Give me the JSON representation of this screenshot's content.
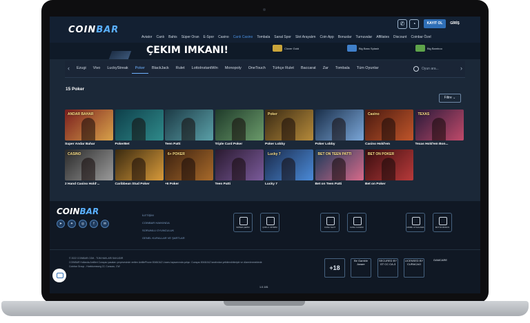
{
  "header": {
    "logo_prefix": "COIN",
    "logo_suffix": "BAR",
    "register_label": "KAYIT OL",
    "login_label": "GİRİŞ",
    "icons": [
      "phone-icon",
      "whatsapp-icon"
    ]
  },
  "main_nav": [
    "Aviator",
    "Canlı",
    "Bahis",
    "Süper Oran",
    "E-Spor",
    "Casino",
    "Canlı Casino",
    "Tombala",
    "Sanal Spor",
    "Slot Arayalım",
    "Coin App",
    "Bonuslar",
    "Turnuvalar",
    "Affiliates",
    "Discount",
    "Coinbar Özel"
  ],
  "main_nav_active": "Canlı Casino",
  "banner": {
    "headline": "ÇEKIM IMKANI!",
    "wins": [
      {
        "label": "Clover Gold",
        "color": "#caa53a"
      },
      {
        "label": "Big Bass Splash",
        "color": "#3f7fc9"
      },
      {
        "label": "Big Bamboo",
        "color": "#5ea34a"
      }
    ]
  },
  "categories": [
    "Ezugi",
    "Vivo",
    "LuckyStreak",
    "Poker",
    "BlackJack",
    "Rulet",
    "LottoInstantWin",
    "Monopoly",
    "OneTouch",
    "Türkçe Rulet",
    "Baccarat",
    "Zar",
    "Tombala",
    "Tüm Oyunlar"
  ],
  "active_category": "Poker",
  "search": {
    "placeholder": "Oyun ara..."
  },
  "results": {
    "count_label": "15 Poker",
    "filter_label": "Filtre"
  },
  "games": [
    {
      "name": "Super Andar Bahar",
      "tag": "ANDAR BAHAR",
      "c1": "#7a1e1e",
      "c2": "#d8a24a"
    },
    {
      "name": "PokerBet",
      "tag": "",
      "c1": "#0e3f4a",
      "c2": "#2f8a8a"
    },
    {
      "name": "Teen Patti",
      "tag": "",
      "c1": "#1c3a45",
      "c2": "#5aa0a8"
    },
    {
      "name": "Triple Card Poker",
      "tag": "",
      "c1": "#1f3b2a",
      "c2": "#6a9a6a"
    },
    {
      "name": "Poker Lobby",
      "tag": "Poker",
      "c1": "#3a2a14",
      "c2": "#b58a3a"
    },
    {
      "name": "Poker Lobby",
      "tag": "",
      "c1": "#1a2f4a",
      "c2": "#7aa6d8"
    },
    {
      "name": "Casino Hold'em",
      "tag": "Casino",
      "c1": "#4a1a10",
      "c2": "#c0552a"
    },
    {
      "name": "Texas Hold'em Bon...",
      "tag": "TEXAS",
      "c1": "#2a1a3a",
      "c2": "#c04a6a"
    },
    {
      "name": "2 Hand Casino Hold'...",
      "tag": "CASINO",
      "c1": "#2a2a2a",
      "c2": "#9a9a9a"
    },
    {
      "name": "Caribbean Stud Poker",
      "tag": "",
      "c1": "#3a2a10",
      "c2": "#d89a3a"
    },
    {
      "name": "+6 Poker",
      "tag": "6+ POKER",
      "c1": "#3a2010",
      "c2": "#a86a2a"
    },
    {
      "name": "Teen Patti",
      "tag": "",
      "c1": "#2a1a30",
      "c2": "#7a5a9a"
    },
    {
      "name": "Lucky 7",
      "tag": "Lucky 7",
      "c1": "#1a2a4a",
      "c2": "#4a8ad8"
    },
    {
      "name": "Bet on Teen Patti",
      "tag": "BET ON TEEN PATTI",
      "c1": "#1a3a5a",
      "c2": "#d86a8a"
    },
    {
      "name": "Bet on Poker",
      "tag": "BET ON POKER",
      "c1": "#3a0e10",
      "c2": "#b83a3a"
    }
  ],
  "footer": {
    "logo_prefix": "COIN",
    "logo_suffix": "BAR",
    "social": [
      "telegram-icon",
      "twitter-icon",
      "instagram-icon",
      "facebook-icon",
      "mail-icon"
    ],
    "links": [
      "İLETİŞİM",
      "COINBAR HAKKINDA",
      "SORUMLU OYUNCULUK",
      "GENEL KURALLAR VE ŞARTLAR"
    ],
    "feature_badges": [
      "SÜPER ÇEKİM",
      "ÇOKLU YATIRIM",
      "CANLI SLOT",
      "CANLI CASINO",
      "MOBİL UYGULAMA",
      "BÜYÜK BONUS"
    ],
    "legal": [
      "© 2022 COINBAR.COM - TÜM HAKLARI SAKLIDIR",
      "COINBAR Hollanda Antilleri Curaçao yasaları çerçevesinde verilen AntillePhone 8048/JAZ Lisans kapsamında çalışır. Curaçao 8048/JAZ tarafından yetkilendirilmiştir ve düzenlenmektedir.",
      "Coinbar Group - Hoektumsweg 22, Curacao, CW"
    ],
    "cert_badges": [
      "+18",
      "Be Gamble Aware",
      "SECURED BY GT CC CA-3",
      "LICENSED BY CURACAO",
      "GAMCARE"
    ],
    "version": "1.0.181"
  }
}
